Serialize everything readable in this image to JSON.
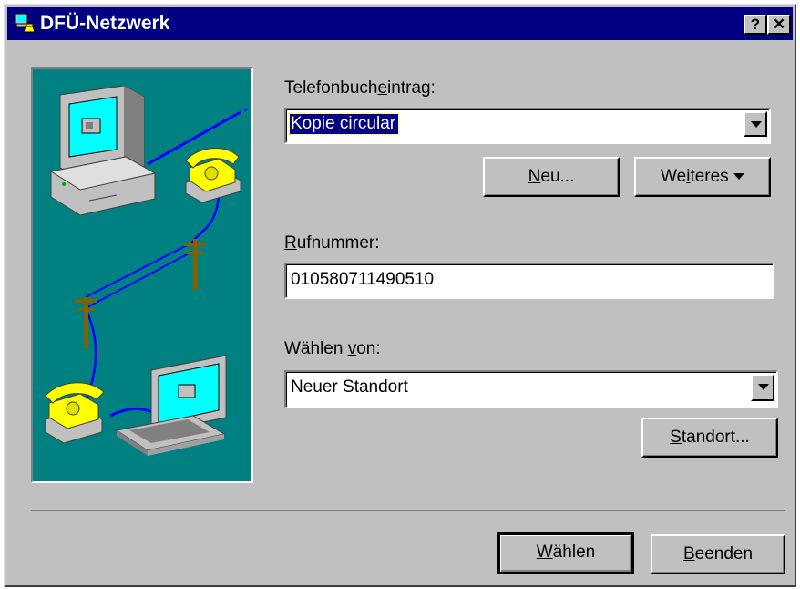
{
  "window": {
    "title": "DFÜ-Netzwerk",
    "help_button": "?",
    "close_button": "✕"
  },
  "phonebook": {
    "label_pre": "Telefonbuch",
    "label_accel": "e",
    "label_post": "intrag:",
    "selected": "Kopie circular"
  },
  "buttons": {
    "new_accel": "N",
    "new_rest": "eu...",
    "more_pre": "We",
    "more_accel": "i",
    "more_post": "teres",
    "location_accel": "S",
    "location_rest": "tandort...",
    "dial_accel": "W",
    "dial_rest": "ählen",
    "exit_accel": "B",
    "exit_rest": "eenden"
  },
  "phone_number": {
    "label_accel": "R",
    "label_rest": "ufnummer:",
    "value": "010580711490510"
  },
  "dial_from": {
    "label_pre": "Wählen ",
    "label_accel": "v",
    "label_post": "on:",
    "selected": "Neuer Standort"
  },
  "colors": {
    "title_bar": "#000080",
    "dialog_face": "#c0c0c0",
    "illustration_bg": "#008080",
    "selection": "#000080"
  }
}
